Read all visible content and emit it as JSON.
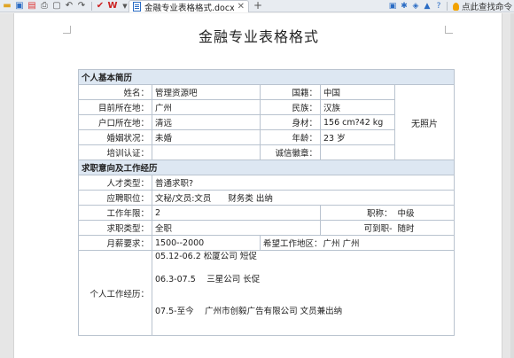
{
  "toolbar": {
    "tab_title": "金融专业表格格式.docx",
    "right_command": "点此查找命令",
    "icons": [
      "folder-icon",
      "save-icon",
      "pdf-icon",
      "print-icon",
      "preview-icon",
      "undo-icon",
      "redo-icon",
      "spellcheck-icon",
      "wps-icon"
    ]
  },
  "document": {
    "title": "金融专业表格格式",
    "section_personal": "个人基本简历",
    "name_label": "姓名：",
    "name_value": "管理资源吧",
    "nationality_label": "国籍：",
    "nationality_value": "中国",
    "photo_text": "无照片",
    "location_label": "目前所在地：",
    "location_value": "广州",
    "ethnicity_label": "民族：",
    "ethnicity_value": "汉族",
    "hukou_label": "户口所在地：",
    "hukou_value": "清远",
    "height_label": "身材：",
    "height_value": "156 cm?42 kg",
    "marital_label": "婚姻状况：",
    "marital_value": "未婚",
    "age_label": "年龄：",
    "age_value": "23 岁",
    "training_label": "培训认证：",
    "training_value": "",
    "credit_label": "诚信徽章：",
    "credit_value": "",
    "section_job": "求职意向及工作经历",
    "talent_type_label": "人才类型：",
    "talent_type_value": "普通求职?",
    "position_label": "应聘职位：",
    "position_value": "文秘/文员:文员　　财务类 出纳",
    "years_label": "工作年限：",
    "years_value": "2",
    "title_label": "职称：",
    "title_value": "中级",
    "jobtype_label": "求职类型：",
    "jobtype_value": "全职",
    "available_label": "可到职-",
    "available_value": "随时",
    "salary_label": "月薪要求：",
    "salary_value": "1500--2000",
    "region_label": "希望工作地区：",
    "region_value": "广州 广州",
    "experience_label": "个人工作经历：",
    "experience": [
      "05.12-06.2 松厦公司 短促",
      "06.3-07.5　 三星公司 长促",
      "07.5-至今　 广州市创毅广告有限公司 文员兼出纳"
    ]
  }
}
